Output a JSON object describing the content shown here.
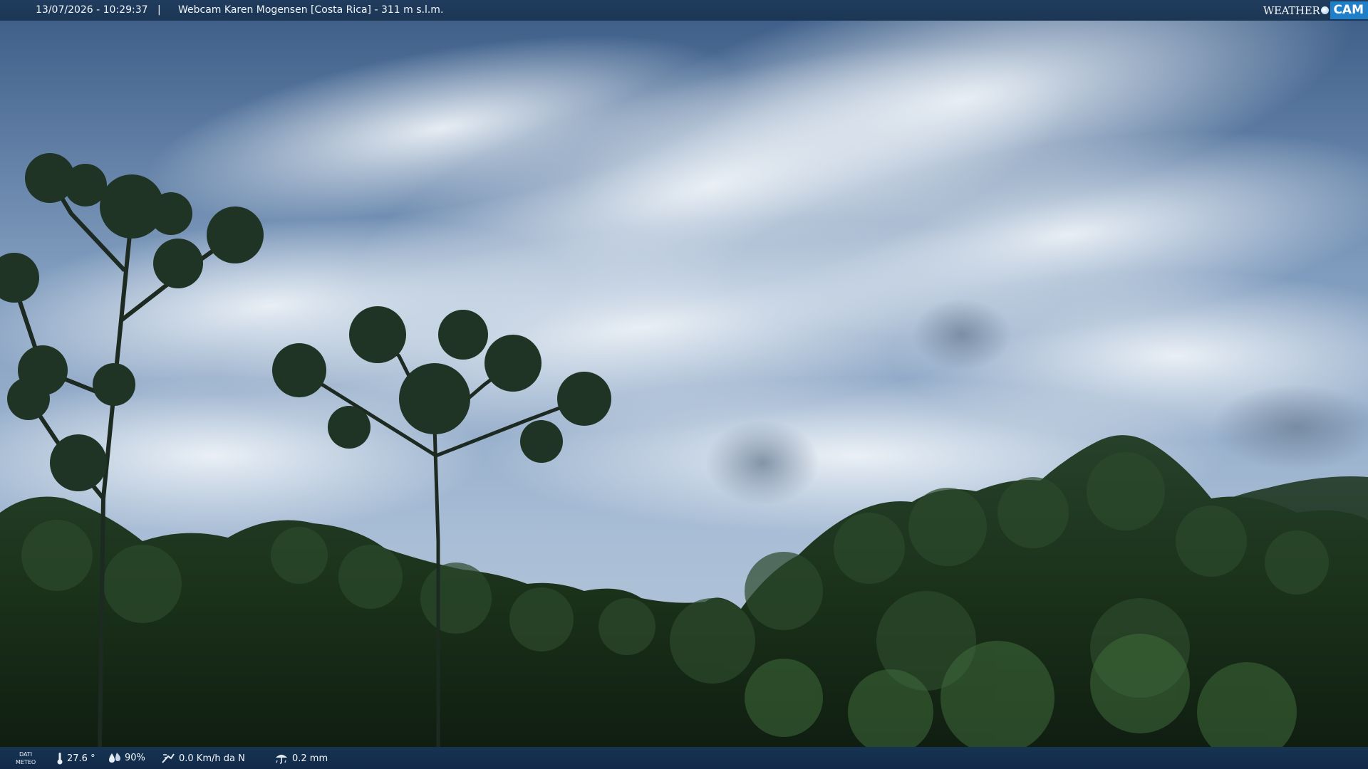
{
  "overlay_top": {
    "datetime": "13/07/2026 - 10:29:37",
    "separator": "|",
    "camera_title": "Webcam Karen Mogensen [Costa Rica] - 311 m s.l.m.",
    "logo_part1": "WEATHER",
    "logo_part2": "CAM"
  },
  "overlay_bottom": {
    "label_line1": "DATI",
    "label_line2": "METEO",
    "temperature": "27.6 °",
    "humidity": "90%",
    "wind": "0.0 Km/h da N",
    "rain": "0.2 mm"
  },
  "icons": {
    "temperature": "thermometer-icon",
    "humidity": "humidity-drop-icon",
    "wind": "wind-icon",
    "rain": "rain-icon"
  },
  "colors": {
    "sky_top": "#3a5b86",
    "sky_mid": "#a9bed6",
    "cloud": "#dfe7f0",
    "forest_dark": "#0d1a10",
    "forest_mid": "#1f3a1d",
    "overlay_bar": "#1c3654",
    "logo_blue": "#1f7fc9"
  }
}
